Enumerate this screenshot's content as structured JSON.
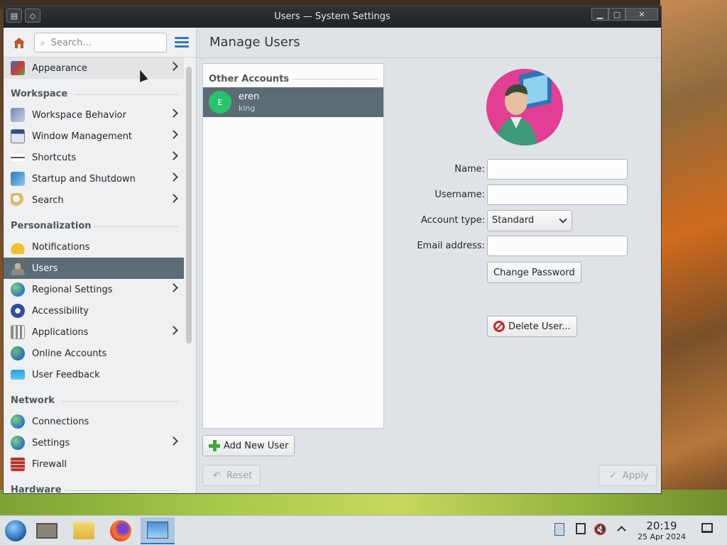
{
  "window": {
    "title": "Users — System Settings"
  },
  "sidebar": {
    "search_placeholder": "Search...",
    "top_item": {
      "label": "Appearance",
      "icon": "appearance-icon"
    },
    "sections": [
      {
        "header": "Workspace",
        "items": [
          {
            "label": "Workspace Behavior",
            "icon": "workspace-behavior-icon",
            "chevron": true
          },
          {
            "label": "Window Management",
            "icon": "window-management-icon",
            "chevron": true
          },
          {
            "label": "Shortcuts",
            "icon": "keyboard-icon",
            "chevron": true
          },
          {
            "label": "Startup and Shutdown",
            "icon": "startup-icon",
            "chevron": true
          },
          {
            "label": "Search",
            "icon": "search-icon",
            "chevron": true
          }
        ]
      },
      {
        "header": "Personalization",
        "items": [
          {
            "label": "Notifications",
            "icon": "bell-icon",
            "chevron": false
          },
          {
            "label": "Users",
            "icon": "users-icon",
            "chevron": false,
            "active": true
          },
          {
            "label": "Regional Settings",
            "icon": "globe-icon",
            "chevron": true
          },
          {
            "label": "Accessibility",
            "icon": "accessibility-icon",
            "chevron": false
          },
          {
            "label": "Applications",
            "icon": "applications-icon",
            "chevron": true
          },
          {
            "label": "Online Accounts",
            "icon": "online-accounts-icon",
            "chevron": false
          },
          {
            "label": "User Feedback",
            "icon": "feedback-icon",
            "chevron": false
          }
        ]
      },
      {
        "header": "Network",
        "items": [
          {
            "label": "Connections",
            "icon": "connections-icon",
            "chevron": false
          },
          {
            "label": "Settings",
            "icon": "network-settings-icon",
            "chevron": true
          },
          {
            "label": "Firewall",
            "icon": "firewall-icon",
            "chevron": false
          }
        ]
      },
      {
        "header": "Hardware",
        "items": []
      }
    ]
  },
  "main": {
    "title": "Manage Users",
    "accounts_header": "Other Accounts",
    "account": {
      "initial": "E",
      "name": "eren",
      "subtitle": "king"
    },
    "add_user_label": "Add New User",
    "reset_label": "Reset",
    "apply_label": "Apply",
    "form": {
      "name_label": "Name:",
      "username_label": "Username:",
      "account_type_label": "Account type:",
      "account_type_value": "Standard",
      "email_label": "Email address:",
      "name_value": "",
      "username_value": "",
      "email_value": "",
      "change_password_label": "Change Password",
      "delete_user_label": "Delete User..."
    }
  },
  "taskbar": {
    "time": "20:19",
    "date": "25 Apr 2024"
  }
}
